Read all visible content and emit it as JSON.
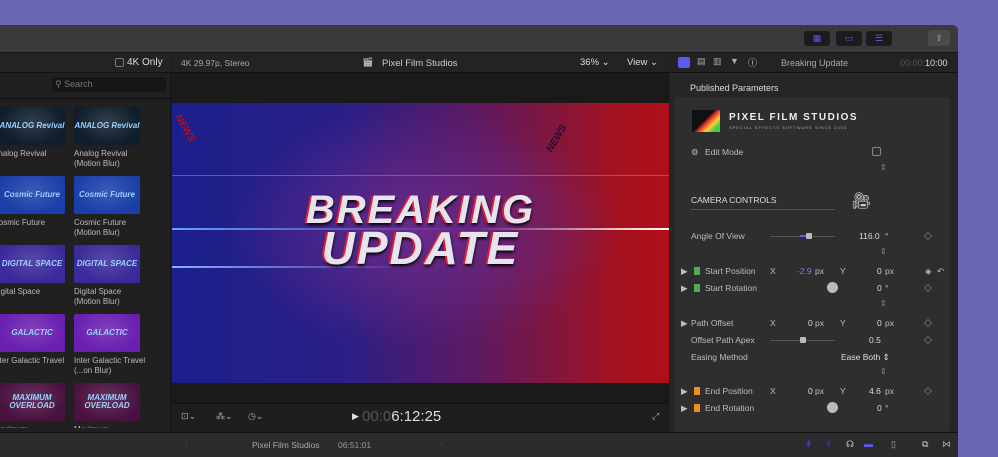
{
  "toolbar": {
    "btn1_icon": "grid-icon",
    "btn2_icon": "filmstrip-icon",
    "btn3_icon": "sliders-icon",
    "share_icon": "share-icon"
  },
  "browser": {
    "filter_label": "4K Only",
    "search_placeholder": "Search",
    "items": [
      {
        "title": "Analog Revival",
        "thumb": "ANALOG Revival",
        "bg": "#0f1d2c"
      },
      {
        "title": "Analog Revival (Motion Blur)",
        "thumb": "ANALOG Revival",
        "bg": "#0f1d2c"
      },
      {
        "title": "Cosmic Future",
        "thumb": "Cosmic Future",
        "bg": "#1a3fa8"
      },
      {
        "title": "Cosmic Future (Motion Blur)",
        "thumb": "Cosmic Future",
        "bg": "#1a3fa8"
      },
      {
        "title": "Digital Space",
        "thumb": "DIGITAL SPACE",
        "bg": "#3a2a9a"
      },
      {
        "title": "Digital Space (Motion Blur)",
        "thumb": "DIGITAL SPACE",
        "bg": "#3a2a9a"
      },
      {
        "title": "Inter Galactic Travel",
        "thumb": "GALACTIC",
        "bg": "#6a1fb0"
      },
      {
        "title": "Inter Galactic Travel (...on Blur)",
        "thumb": "GALACTIC",
        "bg": "#6a1fb0"
      },
      {
        "title": "Maximum",
        "thumb": "MAXIMUM OVERLOAD",
        "bg": "#4a1240"
      },
      {
        "title": "Maximum",
        "thumb": "MAXIMUM OVERLOAD",
        "bg": "#4a1240"
      }
    ]
  },
  "viewer": {
    "format": "4K 29.97p, Stereo",
    "project": "Pixel Film Studios",
    "zoom": "36%",
    "view_label": "View",
    "video_title_line1": "BREAKING",
    "video_title_line2": "UPDATE",
    "video_tag": "NEWS",
    "timecode_dim": "00:0",
    "timecode": "6:12:25"
  },
  "inspector": {
    "title": "Breaking Update",
    "duration_dim": "00:00:",
    "duration": "10:00",
    "section": "Published Parameters",
    "brand": "PIXEL FILM STUDIOS",
    "brand_tagline": "SPECIAL EFFECTS SOFTWARE SINCE 2005",
    "edit_mode": "Edit Mode",
    "camera_controls": "CAMERA CONTROLS",
    "angle_label": "Angle Of View",
    "angle_value": "116.0",
    "angle_slider": 0.6,
    "start_position": {
      "label": "Start Position",
      "x": "-2.9",
      "y": "0"
    },
    "start_rotation": {
      "label": "Start Rotation",
      "value": "0"
    },
    "path_offset": {
      "label": "Path Offset",
      "x": "0",
      "y": "0"
    },
    "apex": {
      "label": "Offset Path Apex",
      "value": "0.5",
      "slider": 0.5
    },
    "easing": {
      "label": "Easing Method",
      "value": "Ease Both"
    },
    "end_position": {
      "label": "End Position",
      "x": "0",
      "y": "4.6"
    },
    "end_rotation": {
      "label": "End Rotation",
      "value": "0"
    },
    "px": "px",
    "deg": "°",
    "x_label": "X",
    "y_label": "Y"
  },
  "timeline": {
    "project": "Pixel Film Studios",
    "duration": "06:51:01"
  },
  "colors": {
    "accent": "#5b5bf0",
    "brand_red": "#c0222a",
    "green_tag": "#4caf50",
    "orange_tag": "#f0901c"
  }
}
